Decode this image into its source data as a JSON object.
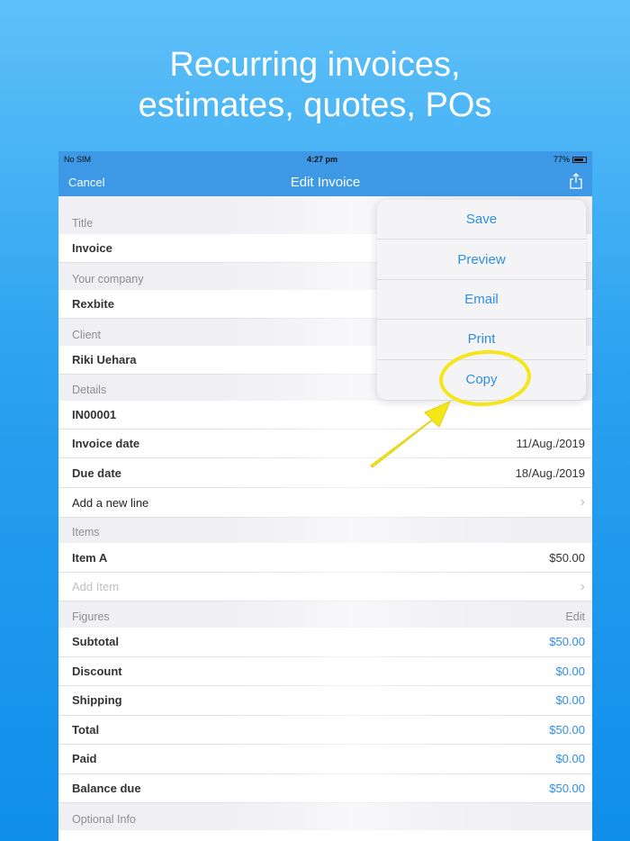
{
  "headline": {
    "line1": "Recurring invoices,",
    "line2": "estimates, quotes, POs"
  },
  "status": {
    "carrier": "No SIM",
    "time": "4:27 pm",
    "battery": "77%"
  },
  "nav": {
    "cancel": "Cancel",
    "title": "Edit Invoice",
    "share_icon": "share-icon"
  },
  "sections": {
    "title": {
      "header": "Title",
      "value": "Invoice"
    },
    "company": {
      "header": "Your company",
      "value": "Rexbite"
    },
    "client": {
      "header": "Client",
      "value": "Riki Uehara"
    },
    "details": {
      "header": "Details",
      "number": "IN00001",
      "invoice_date_label": "Invoice date",
      "invoice_date": "11/Aug./2019",
      "due_date_label": "Due date",
      "due_date": "18/Aug./2019",
      "add_line": "Add a new line"
    },
    "items": {
      "header": "Items",
      "item_name": "Item A",
      "item_price": "$50.00",
      "add_item": "Add Item"
    },
    "figures": {
      "header": "Figures",
      "edit": "Edit",
      "rows": [
        {
          "label": "Subtotal",
          "value": "$50.00"
        },
        {
          "label": "Discount",
          "value": "$0.00"
        },
        {
          "label": "Shipping",
          "value": "$0.00"
        },
        {
          "label": "Total",
          "value": "$50.00"
        },
        {
          "label": "Paid",
          "value": "$0.00"
        },
        {
          "label": "Balance due",
          "value": "$50.00"
        }
      ]
    },
    "optional": {
      "header": "Optional Info"
    }
  },
  "menu": [
    "Save",
    "Preview",
    "Email",
    "Print",
    "Copy"
  ],
  "colors": {
    "accent": "#2d8ee6",
    "nav": "#3d98e6",
    "highlight": "#f5e61a"
  }
}
